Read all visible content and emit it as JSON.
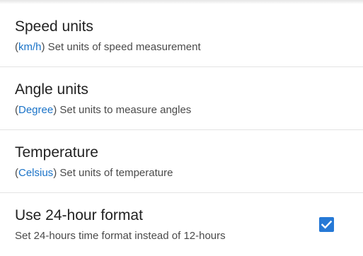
{
  "settings": [
    {
      "title": "Speed units",
      "value": "km/h",
      "description": " Set units of speed measurement"
    },
    {
      "title": "Angle units",
      "value": "Degree",
      "description": " Set units to measure angles"
    },
    {
      "title": "Temperature",
      "value": "Celsius",
      "description": " Set units of temperature"
    },
    {
      "title": "Use 24-hour format",
      "description": "Set 24-hours time format instead of 12-hours",
      "checked": true
    }
  ],
  "colors": {
    "value_accent": "#1a73c8",
    "checkbox_fill": "#2679d6"
  },
  "icons": {
    "checkbox": "check-icon"
  }
}
